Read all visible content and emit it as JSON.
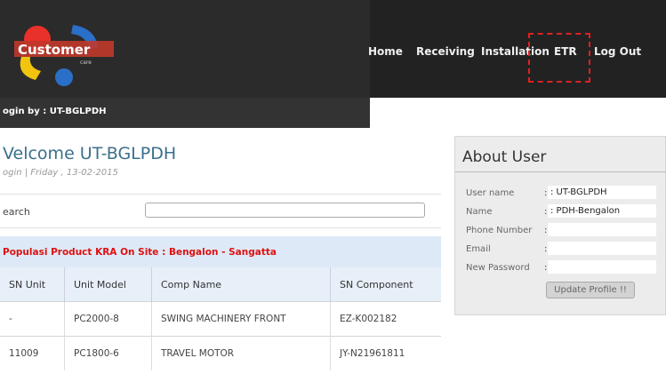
{
  "logo": {
    "text": "Customer",
    "sub": "care"
  },
  "nav": {
    "home": "Home",
    "receiving": "Receiving",
    "installation": "Installation",
    "etr": "ETR",
    "logout": "Log Out"
  },
  "login": {
    "text": "ogin by : UT-BGLPDH"
  },
  "welcome": {
    "title": "Velcome UT-BGLPDH",
    "date": "ogin | Friday , 13-02-2015"
  },
  "search": {
    "label": "earch",
    "value": ""
  },
  "table": {
    "title": "Populasi Product KRA On Site : Bengalon - Sangatta",
    "headers": [
      "SN Unit",
      "Unit Model",
      "Comp Name",
      "SN Component"
    ],
    "rows": [
      [
        "-",
        "PC2000-8",
        "SWING MACHINERY FRONT",
        "EZ-K002182"
      ],
      [
        "11009",
        "PC1800-6",
        "TRAVEL MOTOR",
        "JY-N21961811"
      ]
    ]
  },
  "about": {
    "title": "About User",
    "fields": [
      {
        "label": "User name",
        "value": "UT-BGLPDH"
      },
      {
        "label": "Name",
        "value": "PDH-Bengalon"
      },
      {
        "label": "Phone Number",
        "value": ""
      },
      {
        "label": "Email",
        "value": ""
      },
      {
        "label": "New Password",
        "value": ""
      }
    ],
    "button": "Update Profile !!"
  },
  "colors": {
    "header_bg": "#1f1f1f",
    "accent_blue": "#3b6f8c",
    "alert_red": "#e01010",
    "highlight_dash": "#e02020"
  }
}
